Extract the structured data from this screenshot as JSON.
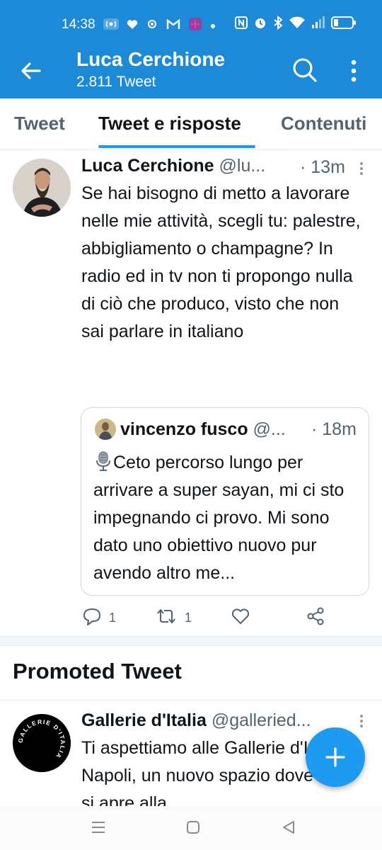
{
  "status_bar": {
    "time": "14:38",
    "left_icons": [
      "radio-icon",
      "heart-icon",
      "app-icon",
      "gmail-icon",
      "app-icon",
      "dot-icon"
    ],
    "right_icons": [
      "nfc-icon",
      "alarm-icon",
      "bluetooth-icon",
      "wifi-icon",
      "signal-icon",
      "battery-icon"
    ]
  },
  "header": {
    "title": "Luca Cerchione",
    "subtitle": "2.811 Tweet",
    "back_icon": "arrow-left-icon",
    "search_icon": "search-icon",
    "more_icon": "more-vertical-icon"
  },
  "tabs": [
    {
      "label": "Tweet",
      "active": false
    },
    {
      "label": "Tweet e risposte",
      "active": true
    },
    {
      "label": "Contenuti",
      "active": false
    }
  ],
  "tweet": {
    "author_name": "Luca Cerchione",
    "handle": "@lu...",
    "time": "· 13m",
    "text": "Se hai bisogno di metto a lavorare nelle mie attività, scegli tu: palestre, abbigliamento o champagne? In radio ed in tv non ti propongo nulla di ciò che produco, visto che non sai parlare in italiano",
    "quote": {
      "author_name": "vincenzo fusco",
      "handle": "@...",
      "time": "· 18m",
      "text": "Ceto percorso lungo per arrivare a super sayan, mi ci sto impegnando ci provo. Mi sono dato uno obiettivo nuovo pur avendo altro me..."
    },
    "actions": {
      "reply_count": "1",
      "retweet_count": "1",
      "like_count": "",
      "icons": [
        "reply-icon",
        "retweet-icon",
        "like-icon",
        "share-icon"
      ]
    }
  },
  "promoted": {
    "section_title": "Promoted Tweet",
    "author_name": "Gallerie d'Italia",
    "handle": "@galleried...",
    "text": "Ti aspettiamo alle Gallerie d'Italia - Napoli, un nuovo spazio dove l'arte si apre alla",
    "logo_text": "GALLERIE D'ITALIA"
  },
  "fab": {
    "icon": "plus-icon"
  },
  "nav_bar": {
    "icons": [
      "recents-icon",
      "home-icon",
      "back-icon"
    ]
  },
  "colors": {
    "primary": "#1d8ad7",
    "accent": "#1d9bf0",
    "text": "#0f1419",
    "muted": "#536471"
  }
}
